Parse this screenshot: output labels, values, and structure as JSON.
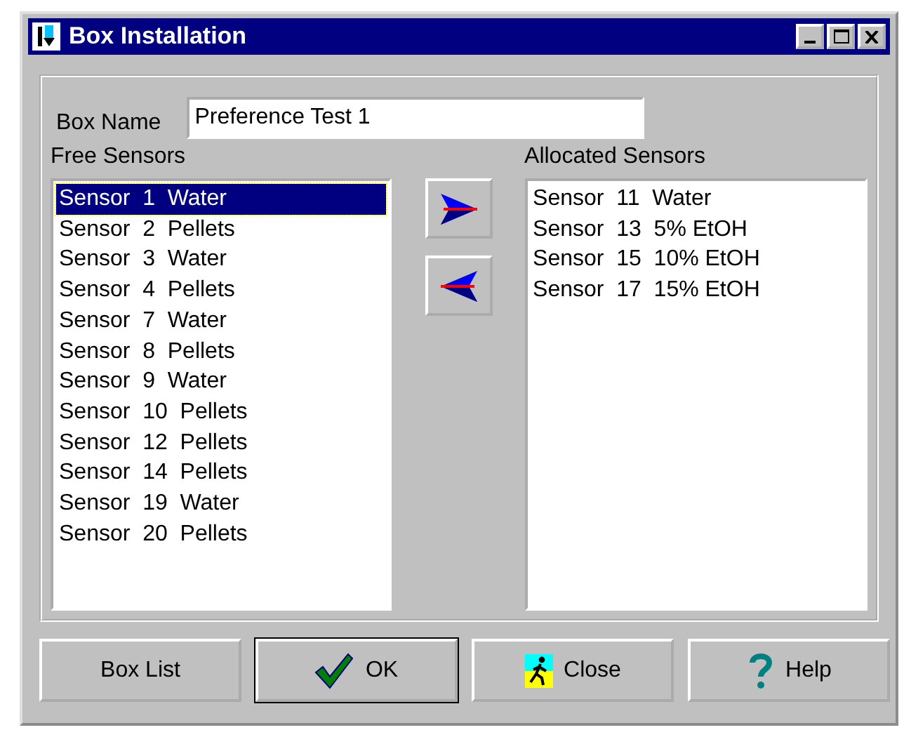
{
  "window": {
    "title": "Box Installation"
  },
  "box_name": {
    "label": "Box Name",
    "value": "Preference Test 1"
  },
  "free_sensors": {
    "label": "Free Sensors",
    "items": [
      {
        "label": "Sensor  1  Water",
        "selected": true
      },
      {
        "label": "Sensor  2  Pellets",
        "selected": false
      },
      {
        "label": "Sensor  3  Water",
        "selected": false
      },
      {
        "label": "Sensor  4  Pellets",
        "selected": false
      },
      {
        "label": "Sensor  7  Water",
        "selected": false
      },
      {
        "label": "Sensor  8  Pellets",
        "selected": false
      },
      {
        "label": "Sensor  9  Water",
        "selected": false
      },
      {
        "label": "Sensor  10  Pellets",
        "selected": false
      },
      {
        "label": "Sensor  12  Pellets",
        "selected": false
      },
      {
        "label": "Sensor  14  Pellets",
        "selected": false
      },
      {
        "label": "Sensor  19  Water",
        "selected": false
      },
      {
        "label": "Sensor  20  Pellets",
        "selected": false
      }
    ]
  },
  "allocated_sensors": {
    "label": "Allocated Sensors",
    "items": [
      {
        "label": "Sensor  11  Water",
        "selected": false
      },
      {
        "label": "Sensor  13  5% EtOH",
        "selected": false
      },
      {
        "label": "Sensor  15  10% EtOH",
        "selected": false
      },
      {
        "label": "Sensor  17  15% EtOH",
        "selected": false
      }
    ]
  },
  "buttons": [
    {
      "label": "Box List",
      "kind": "plain",
      "default": false
    },
    {
      "label": "OK",
      "kind": "ok",
      "default": true
    },
    {
      "label": "Close",
      "kind": "close",
      "default": false
    },
    {
      "label": "Help",
      "kind": "help",
      "default": false
    }
  ]
}
